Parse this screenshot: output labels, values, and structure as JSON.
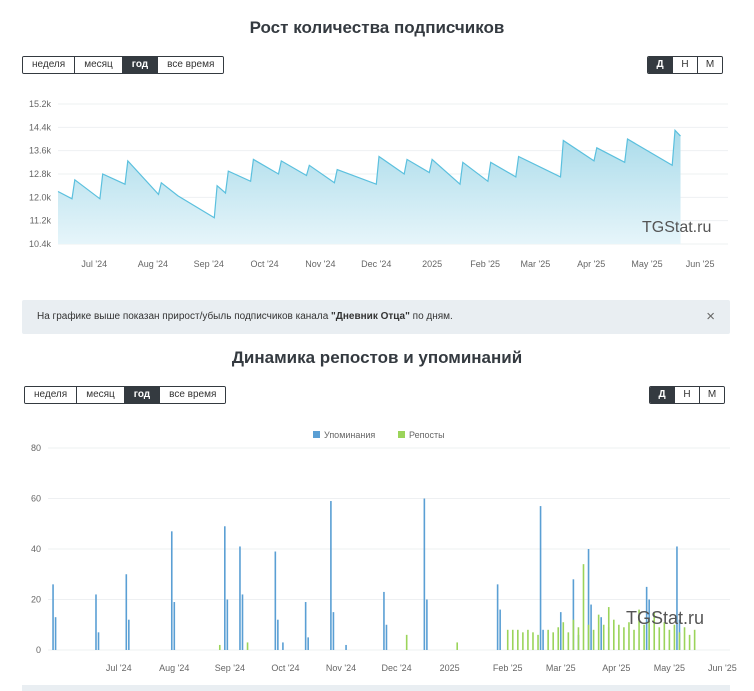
{
  "top": {
    "title": "Рост количества подписчиков",
    "range_buttons": [
      "неделя",
      "месяц",
      "год",
      "все время"
    ],
    "range_active": 2,
    "period_buttons": [
      "Д",
      "Н",
      "М"
    ],
    "period_active": 0,
    "watermark": "TGStat.ru",
    "info_prefix": "На графике выше показан прирост/убыль подписчиков канала ",
    "info_channel": "\"Дневник Отца\"",
    "info_suffix": " по дням.",
    "close_glyph": "×"
  },
  "bottom": {
    "title": "Динамика репостов и упоминаний",
    "range_buttons": [
      "неделя",
      "месяц",
      "год",
      "все время"
    ],
    "range_active": 2,
    "period_buttons": [
      "Д",
      "Н",
      "М"
    ],
    "period_active": 0,
    "watermark": "TGStat.ru",
    "legend_colors": {
      "mentions": "#5a9fd4",
      "reposts": "#9bd45a"
    }
  },
  "chart_data": [
    {
      "type": "area",
      "title": "Рост количества подписчиков",
      "x_ticks": [
        "Jul '24",
        "Aug '24",
        "Sep '24",
        "Oct '24",
        "Nov '24",
        "Dec '24",
        "2025",
        "Feb '25",
        "Mar '25",
        "Apr '25",
        "May '25",
        "Jun '25"
      ],
      "y_ticks": [
        "10.4k",
        "11.2k",
        "12.0k",
        "12.8k",
        "13.6k",
        "14.4k",
        "15.2k"
      ],
      "ylim": [
        10400,
        15200
      ],
      "color": "#5bc0de",
      "points": [
        {
          "x": 0.0,
          "y": 12200
        },
        {
          "x": 0.5,
          "y": 11950
        },
        {
          "x": 0.6,
          "y": 12600
        },
        {
          "x": 1.5,
          "y": 11950
        },
        {
          "x": 1.6,
          "y": 12800
        },
        {
          "x": 2.4,
          "y": 12450
        },
        {
          "x": 2.5,
          "y": 13250
        },
        {
          "x": 3.6,
          "y": 12100
        },
        {
          "x": 3.7,
          "y": 12500
        },
        {
          "x": 4.3,
          "y": 12050
        },
        {
          "x": 5.6,
          "y": 11300
        },
        {
          "x": 5.7,
          "y": 12400
        },
        {
          "x": 6.0,
          "y": 12150
        },
        {
          "x": 6.1,
          "y": 12900
        },
        {
          "x": 6.9,
          "y": 12550
        },
        {
          "x": 7.0,
          "y": 13300
        },
        {
          "x": 7.9,
          "y": 12800
        },
        {
          "x": 8.0,
          "y": 13250
        },
        {
          "x": 8.9,
          "y": 12750
        },
        {
          "x": 9.0,
          "y": 13100
        },
        {
          "x": 9.9,
          "y": 12500
        },
        {
          "x": 10.0,
          "y": 12950
        },
        {
          "x": 11.4,
          "y": 12450
        },
        {
          "x": 11.5,
          "y": 13400
        },
        {
          "x": 12.4,
          "y": 12800
        },
        {
          "x": 12.5,
          "y": 13300
        },
        {
          "x": 13.3,
          "y": 12850
        },
        {
          "x": 13.4,
          "y": 13300
        },
        {
          "x": 14.4,
          "y": 12450
        },
        {
          "x": 14.5,
          "y": 13200
        },
        {
          "x": 15.4,
          "y": 12550
        },
        {
          "x": 15.5,
          "y": 13200
        },
        {
          "x": 16.4,
          "y": 12700
        },
        {
          "x": 16.5,
          "y": 13400
        },
        {
          "x": 18.0,
          "y": 12700
        },
        {
          "x": 18.1,
          "y": 13950
        },
        {
          "x": 19.2,
          "y": 13250
        },
        {
          "x": 19.3,
          "y": 13700
        },
        {
          "x": 20.3,
          "y": 13200
        },
        {
          "x": 20.4,
          "y": 14000
        },
        {
          "x": 22.0,
          "y": 13100
        },
        {
          "x": 22.1,
          "y": 14300
        },
        {
          "x": 22.3,
          "y": 14100
        }
      ],
      "x_tick_positions": [
        1.3,
        3.4,
        5.4,
        7.4,
        9.4,
        11.4,
        13.4,
        15.3,
        17.1,
        19.1,
        21.1,
        23.0
      ],
      "x_max": 24
    },
    {
      "type": "bar",
      "title": "Динамика репостов и упоминаний",
      "series": [
        {
          "name": "Упоминания",
          "color": "#5a9fd4",
          "bars": [
            [
              0.2,
              26
            ],
            [
              0.3,
              13
            ],
            [
              1.9,
              22
            ],
            [
              2.0,
              7
            ],
            [
              3.1,
              30
            ],
            [
              3.2,
              12
            ],
            [
              4.9,
              47
            ],
            [
              5.0,
              19
            ],
            [
              7.0,
              49
            ],
            [
              7.1,
              20
            ],
            [
              7.6,
              41
            ],
            [
              7.7,
              22
            ],
            [
              9.0,
              39
            ],
            [
              9.1,
              12
            ],
            [
              9.3,
              3
            ],
            [
              10.2,
              19
            ],
            [
              10.3,
              5
            ],
            [
              11.2,
              59
            ],
            [
              11.3,
              15
            ],
            [
              11.8,
              2
            ],
            [
              13.3,
              23
            ],
            [
              13.4,
              10
            ],
            [
              14.9,
              60
            ],
            [
              15.0,
              20
            ],
            [
              17.8,
              26
            ],
            [
              17.9,
              16
            ],
            [
              19.5,
              57
            ],
            [
              19.6,
              8
            ],
            [
              20.3,
              15
            ],
            [
              20.8,
              28
            ],
            [
              21.0,
              6
            ],
            [
              21.4,
              40
            ],
            [
              21.5,
              18
            ],
            [
              21.9,
              13
            ],
            [
              22.2,
              9
            ],
            [
              23.7,
              25
            ],
            [
              23.8,
              20
            ],
            [
              24.9,
              41
            ],
            [
              25.0,
              12
            ]
          ]
        },
        {
          "name": "Репосты",
          "color": "#9bd45a",
          "bars": [
            [
              6.8,
              2
            ],
            [
              7.9,
              3
            ],
            [
              14.2,
              6
            ],
            [
              16.2,
              3
            ],
            [
              18.2,
              8
            ],
            [
              18.4,
              8
            ],
            [
              18.6,
              8
            ],
            [
              18.8,
              7
            ],
            [
              19.0,
              8
            ],
            [
              19.2,
              7
            ],
            [
              19.4,
              6
            ],
            [
              19.8,
              8
            ],
            [
              20.0,
              7
            ],
            [
              20.2,
              9
            ],
            [
              20.4,
              11
            ],
            [
              20.6,
              7
            ],
            [
              20.8,
              12
            ],
            [
              21.0,
              9
            ],
            [
              21.2,
              34
            ],
            [
              21.4,
              10
            ],
            [
              21.6,
              8
            ],
            [
              21.8,
              14
            ],
            [
              22.0,
              10
            ],
            [
              22.2,
              17
            ],
            [
              22.4,
              12
            ],
            [
              22.6,
              10
            ],
            [
              22.8,
              9
            ],
            [
              23.0,
              11
            ],
            [
              23.2,
              8
            ],
            [
              23.4,
              16
            ],
            [
              23.6,
              10
            ],
            [
              23.8,
              12
            ],
            [
              24.0,
              15
            ],
            [
              24.2,
              9
            ],
            [
              24.4,
              11
            ],
            [
              24.6,
              8
            ],
            [
              24.8,
              10
            ],
            [
              25.0,
              7
            ],
            [
              25.2,
              9
            ],
            [
              25.4,
              6
            ],
            [
              25.6,
              8
            ]
          ]
        }
      ],
      "x_ticks": [
        "Jul '24",
        "Aug '24",
        "Sep '24",
        "Oct '24",
        "Nov '24",
        "Dec '24",
        "2025",
        "Feb '25",
        "Mar '25",
        "Apr '25",
        "May '25",
        "Jun '25"
      ],
      "x_tick_positions": [
        2.8,
        5.0,
        7.2,
        9.4,
        11.6,
        13.8,
        15.9,
        18.2,
        20.3,
        22.5,
        24.6,
        26.7
      ],
      "x_max": 27,
      "y_ticks": [
        "0",
        "20",
        "40",
        "60",
        "80"
      ],
      "ylim": [
        0,
        80
      ]
    }
  ]
}
